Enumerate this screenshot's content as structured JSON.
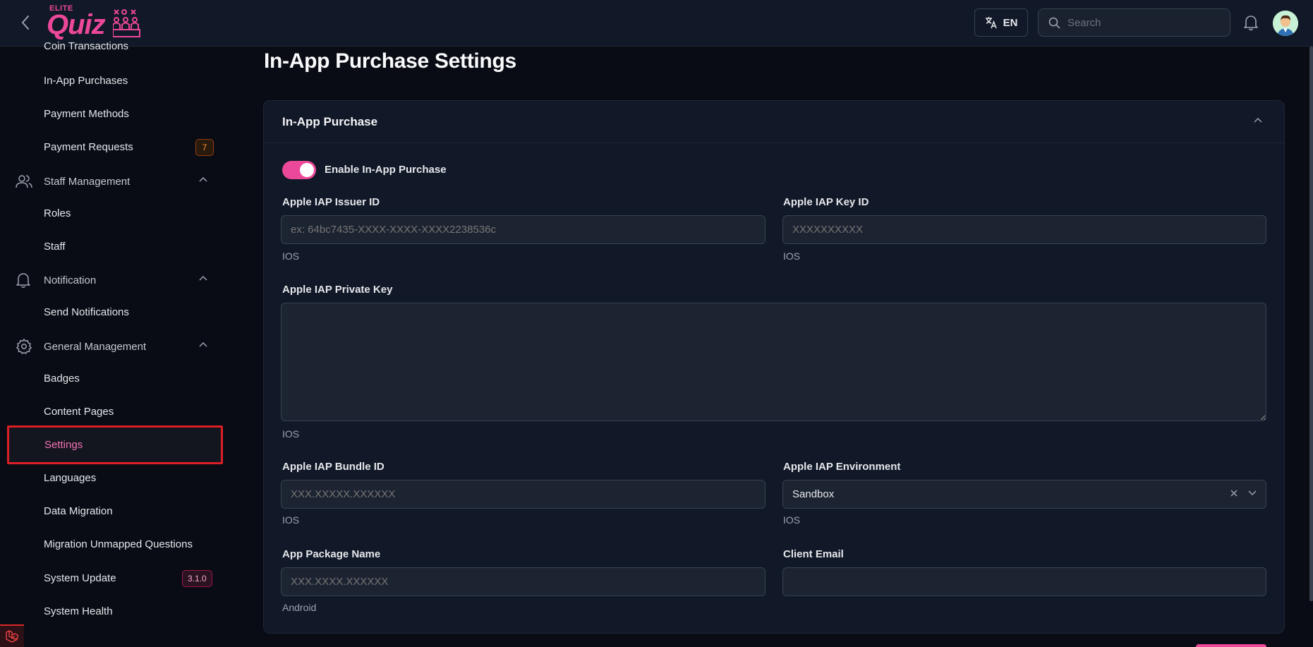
{
  "header": {
    "logo_small": "ELITE",
    "logo_main": "Quiz",
    "language_label": "EN",
    "search_placeholder": "Search"
  },
  "sidebar": {
    "items": [
      {
        "label": "Coin Transactions"
      },
      {
        "label": "In-App Purchases"
      },
      {
        "label": "Payment Methods"
      },
      {
        "label": "Payment Requests",
        "badge": "7"
      },
      {
        "label": "Staff Management",
        "group": true
      },
      {
        "label": "Roles"
      },
      {
        "label": "Staff"
      },
      {
        "label": "Notification",
        "group": true
      },
      {
        "label": "Send Notifications"
      },
      {
        "label": "General Management",
        "group": true
      },
      {
        "label": "Badges"
      },
      {
        "label": "Content Pages"
      },
      {
        "label": "Settings",
        "active": true
      },
      {
        "label": "Languages"
      },
      {
        "label": "Data Migration"
      },
      {
        "label": "Migration Unmapped Questions"
      },
      {
        "label": "System Update",
        "badge": "3.1.0"
      },
      {
        "label": "System Health"
      }
    ]
  },
  "main": {
    "page_title": "In-App Purchase Settings",
    "card_title": "In-App Purchase",
    "toggle": {
      "label": "Enable In-App Purchase",
      "enabled": true
    },
    "fields": {
      "issuer_id": {
        "label": "Apple IAP Issuer ID",
        "value": "",
        "placeholder": "ex: 64bc7435-XXXX-XXXX-XXXX2238536c",
        "hint": "IOS"
      },
      "key_id": {
        "label": "Apple IAP Key ID",
        "value": "",
        "placeholder": "XXXXXXXXXX",
        "hint": "IOS"
      },
      "private_key": {
        "label": "Apple IAP Private Key",
        "value": "",
        "hint": "IOS"
      },
      "bundle_id": {
        "label": "Apple IAP Bundle ID",
        "value": "",
        "placeholder": "XXX.XXXXX.XXXXXX",
        "hint": "IOS"
      },
      "environment": {
        "label": "Apple IAP Environment",
        "value": "Sandbox",
        "hint": "IOS"
      },
      "package_name": {
        "label": "App Package Name",
        "value": "",
        "placeholder": "XXX.XXXX.XXXXXX",
        "hint": "Android"
      },
      "client_email": {
        "label": "Client Email",
        "value": "",
        "placeholder": ""
      }
    }
  },
  "colors": {
    "accent": "#ec4899",
    "highlight_border": "#dc1f26",
    "background": "#090c14",
    "card": "#111827"
  }
}
